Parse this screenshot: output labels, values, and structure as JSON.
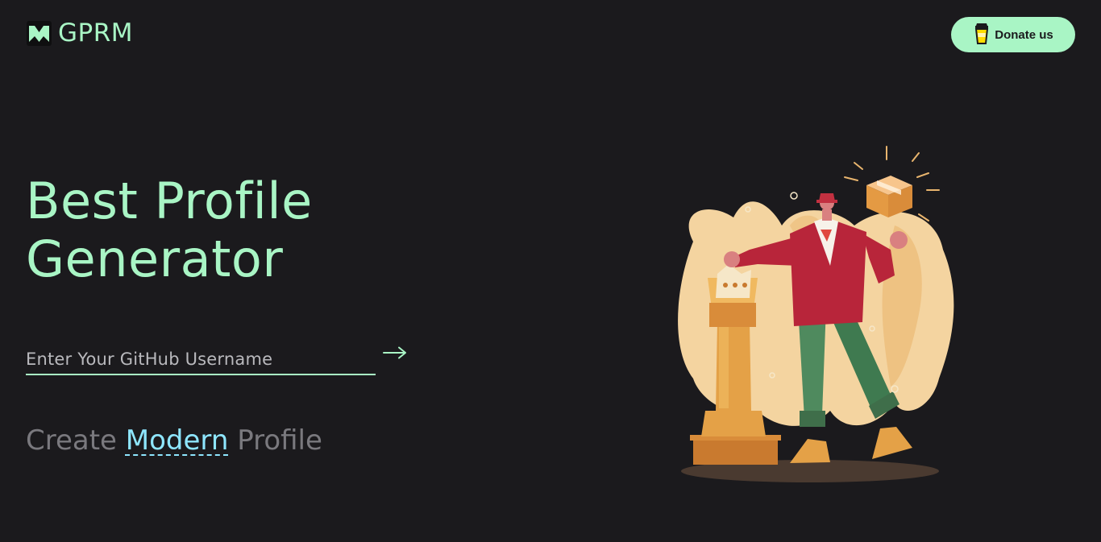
{
  "header": {
    "brand": "GPRM",
    "brand_icon": "gprm-logo-icon",
    "donate_label": "Donate us",
    "donate_icon": "coffee-cup-icon"
  },
  "hero": {
    "title_line1": "Best Profile",
    "title_line2": "Generator",
    "input_placeholder": "Enter Your GitHub Username",
    "input_value": "",
    "submit_icon": "arrow-right-icon",
    "tagline_prefix": "Create",
    "tagline_highlight": "Modern",
    "tagline_suffix": "Profile"
  },
  "illustration": {
    "subject": "man-with-box-and-trophy-illustration"
  },
  "colors": {
    "background": "#1b1a1d",
    "accent": "#a9f5c5",
    "highlight": "#8ee6ff",
    "muted_text": "#7a797e"
  }
}
